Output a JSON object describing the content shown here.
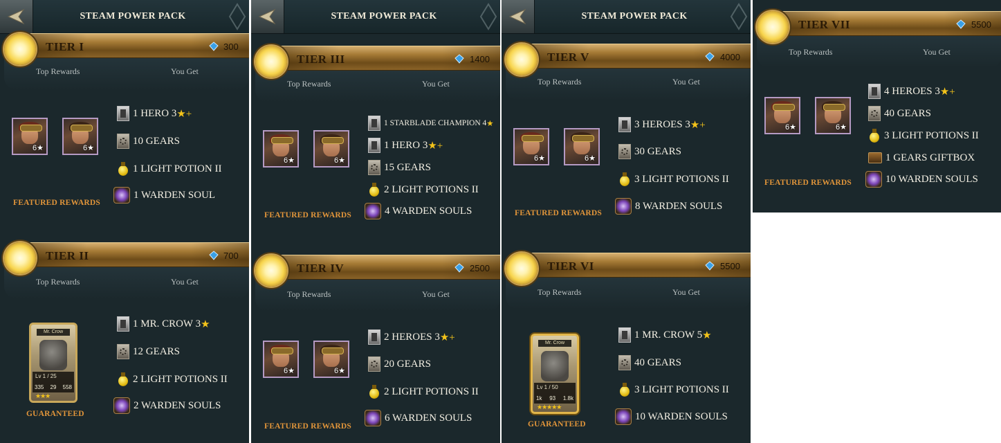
{
  "screens": [
    {
      "title": "STEAM POWER PACK",
      "tiers": [
        {
          "label": "TIER I",
          "cost": "300",
          "top_rewards": "Top Rewards",
          "you_get": "You Get",
          "items": [
            "1 HERO 3",
            "10 GEARS",
            "1 LIGHT POTION II",
            "1 WARDEN SOUL"
          ],
          "item_suffix": [
            "★+",
            "",
            "",
            ""
          ],
          "featured": "FEATURED REWARDS",
          "portrait_badge": "6★"
        },
        {
          "label": "TIER II",
          "cost": "700",
          "top_rewards": "Top Rewards",
          "you_get": "You Get",
          "items": [
            "1 MR. CROW 3",
            "12 GEARS",
            "2 LIGHT POTIONS II",
            "2 WARDEN SOULS"
          ],
          "item_suffix": [
            "★",
            "",
            "",
            ""
          ],
          "featured": "GUARANTEED",
          "card": {
            "name": "Mr. Crow",
            "level": "Lv 1 / 25",
            "stats": [
              "335",
              "29",
              "558"
            ],
            "stars": "★★★"
          }
        }
      ]
    },
    {
      "title": "STEAM POWER PACK",
      "tiers": [
        {
          "label": "TIER III",
          "cost": "1400",
          "top_rewards": "Top Rewards",
          "you_get": "You Get",
          "items": [
            "1 STARBLADE CHAMPION 4",
            "1 HERO 3",
            "15 GEARS",
            "2 LIGHT POTIONS II",
            "4 WARDEN SOULS"
          ],
          "item_suffix": [
            "★",
            "★+",
            "",
            "",
            ""
          ],
          "featured": "FEATURED REWARDS",
          "portrait_badge": "6★"
        },
        {
          "label": "TIER IV",
          "cost": "2500",
          "top_rewards": "Top Rewards",
          "you_get": "You Get",
          "items": [
            "2 HEROES 3",
            "20 GEARS",
            "2 LIGHT POTIONS II",
            "6 WARDEN SOULS"
          ],
          "item_suffix": [
            "★+",
            "",
            "",
            ""
          ],
          "featured": "FEATURED REWARDS",
          "portrait_badge": "6★"
        }
      ]
    },
    {
      "title": "STEAM POWER PACK",
      "tiers": [
        {
          "label": "TIER V",
          "cost": "4000",
          "top_rewards": "Top Rewards",
          "you_get": "You Get",
          "items": [
            "3 HEROES 3",
            "30 GEARS",
            "3 LIGHT POTIONS II",
            "8 WARDEN SOULS"
          ],
          "item_suffix": [
            "★+",
            "",
            "",
            ""
          ],
          "featured": "FEATURED REWARDS",
          "portrait_badge": "6★"
        },
        {
          "label": "TIER VI",
          "cost": "5500",
          "top_rewards": "Top Rewards",
          "you_get": "You Get",
          "items": [
            "1 MR. CROW 5",
            "40 GEARS",
            "3 LIGHT POTIONS II",
            "10 WARDEN SOULS"
          ],
          "item_suffix": [
            "★",
            "",
            "",
            ""
          ],
          "featured": "GUARANTEED",
          "card": {
            "name": "Mr. Crow",
            "level": "Lv 1 / 50",
            "stats": [
              "1k",
              "93",
              "1.8k"
            ],
            "stars": "★★★★★"
          }
        }
      ]
    },
    {
      "title": "",
      "tiers": [
        {
          "label": "TIER VII",
          "cost": "5500",
          "top_rewards": "Top Rewards",
          "you_get": "You Get",
          "items": [
            "4 HEROES 3",
            "40 GEARS",
            "3 LIGHT POTIONS II",
            "1 GEARS GIFTBOX",
            "10 WARDEN SOULS"
          ],
          "item_suffix": [
            "★+",
            "",
            "",
            "",
            ""
          ],
          "featured": "FEATURED REWARDS",
          "portrait_badge": "6★"
        }
      ]
    }
  ],
  "colors": {
    "accent_gold": "#c79f4e",
    "featured_orange": "#e1953a",
    "panel_bg": "#1b282c",
    "gem_blue": "#3aa0e6"
  }
}
